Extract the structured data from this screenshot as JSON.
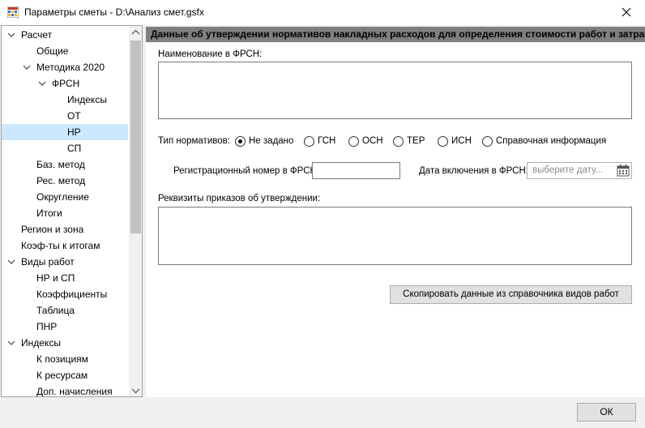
{
  "window": {
    "title": "Параметры сметы - D:\\Анализ смет.gsfx"
  },
  "tree": {
    "items": [
      {
        "label": "Расчет",
        "level": 0,
        "expanded": true
      },
      {
        "label": "Общие",
        "level": 1
      },
      {
        "label": "Методика 2020",
        "level": 1,
        "expanded": true
      },
      {
        "label": "ФРСН",
        "level": 2,
        "expanded": true
      },
      {
        "label": "Индексы",
        "level": 3
      },
      {
        "label": "ОТ",
        "level": 3
      },
      {
        "label": "НР",
        "level": 3,
        "selected": true
      },
      {
        "label": "СП",
        "level": 3
      },
      {
        "label": "Баз. метод",
        "level": 1
      },
      {
        "label": "Рес. метод",
        "level": 1
      },
      {
        "label": "Округление",
        "level": 1
      },
      {
        "label": "Итоги",
        "level": 1
      },
      {
        "label": "Регион и зона",
        "level": 0
      },
      {
        "label": "Коэф-ты к итогам",
        "level": 0
      },
      {
        "label": "Виды работ",
        "level": 0,
        "expanded": true
      },
      {
        "label": "НР и СП",
        "level": 1
      },
      {
        "label": "Коэффициенты",
        "level": 1
      },
      {
        "label": "Таблица",
        "level": 1
      },
      {
        "label": "ПНР",
        "level": 1
      },
      {
        "label": "Индексы",
        "level": 0,
        "expanded": true
      },
      {
        "label": "К позициям",
        "level": 1
      },
      {
        "label": "К ресурсам",
        "level": 1
      },
      {
        "label": "Доп. начисления",
        "level": 1
      }
    ]
  },
  "panel": {
    "header": "Данные об утверждении нормативов накладных расходов для определения стоимости работ и затрат",
    "name_label": "Наименование в ФРСН:",
    "name_value": "",
    "norm_type_label": "Тип нормативов:",
    "norm_types": [
      {
        "label": "Не задано",
        "selected": true
      },
      {
        "label": "ГСН",
        "selected": false
      },
      {
        "label": "ОСН",
        "selected": false
      },
      {
        "label": "ТЕР",
        "selected": false
      },
      {
        "label": "ИСН",
        "selected": false
      },
      {
        "label": "Справочная информация",
        "selected": false
      }
    ],
    "reg_label": "Регистрационный номер в ФРСН:",
    "reg_value": "",
    "date_label": "Дата включения в ФРСН:",
    "date_placeholder": "выберите дату...",
    "orders_label": "Реквизиты приказов об утверждении:",
    "orders_value": "",
    "copy_button": "Скопировать данные из справочника видов работ"
  },
  "footer": {
    "ok_button": "ОК"
  }
}
